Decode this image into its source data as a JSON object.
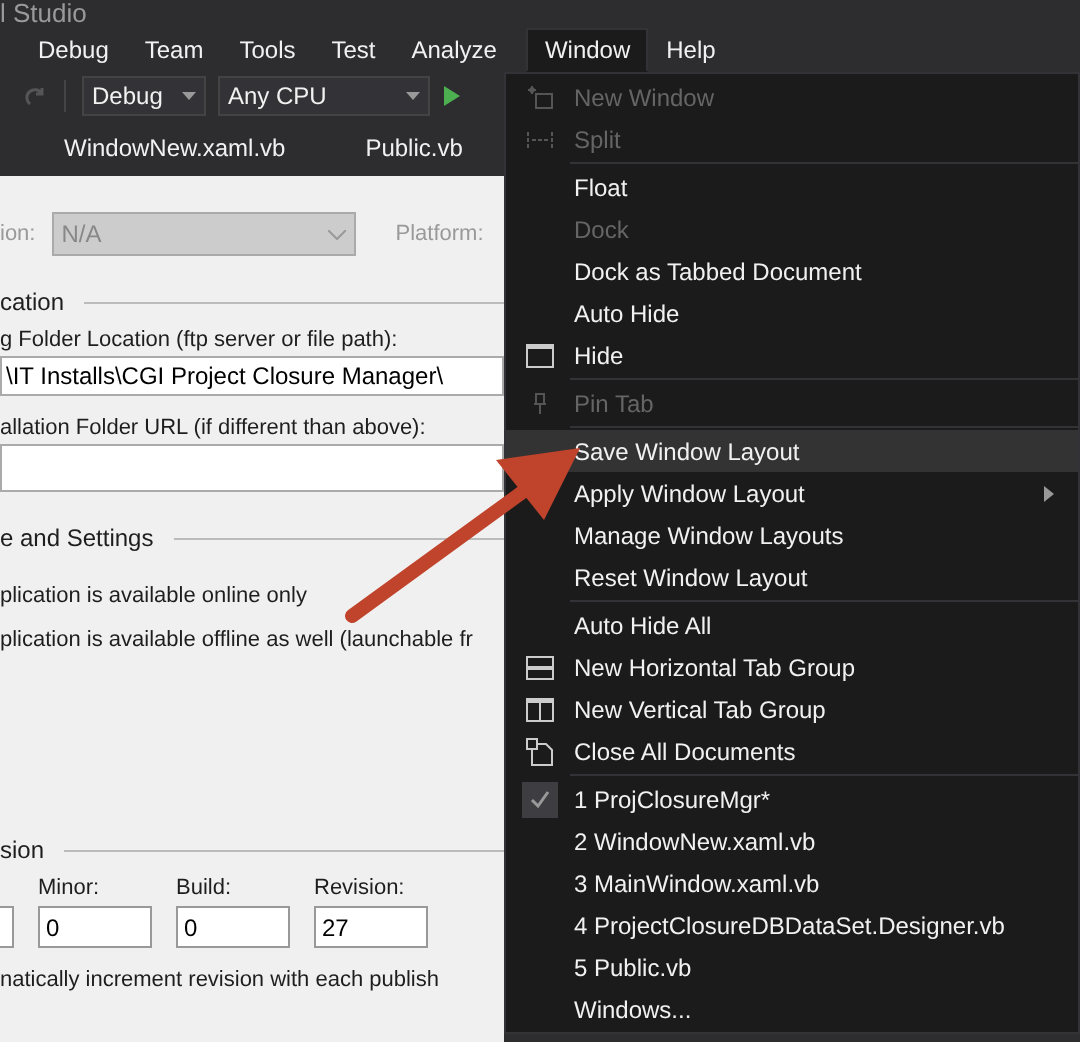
{
  "window": {
    "title": "l Studio"
  },
  "menu_bar": [
    {
      "label": "Debug",
      "selected": false
    },
    {
      "label": "Team",
      "selected": false
    },
    {
      "label": "Tools",
      "selected": false
    },
    {
      "label": "Test",
      "selected": false
    },
    {
      "label": "Analyze",
      "selected": false
    },
    {
      "label": "Window",
      "selected": true
    },
    {
      "label": "Help",
      "selected": false
    }
  ],
  "toolbar": {
    "configuration": "Debug",
    "platform": "Any CPU"
  },
  "tabs": [
    {
      "label": "WindowNew.xaml.vb"
    },
    {
      "label": "Public.vb"
    }
  ],
  "form": {
    "configuration_label": "ion:",
    "configuration_value": "N/A",
    "platform_label": "Platform:",
    "publish_section": "cation",
    "folder_label": "g Folder Location (ftp server or file path):",
    "folder_value": "\\IT Installs\\CGI Project Closure Manager\\",
    "install_label": "allation Folder URL (if different than above):",
    "settings_section": "e and Settings",
    "options": [
      "plication is available online only",
      "plication is available offline as well (launchable fr"
    ],
    "version_section": "sion",
    "version_fields": [
      {
        "label": "Minor:",
        "value": "0"
      },
      {
        "label": "Build:",
        "value": "0"
      },
      {
        "label": "Revision:",
        "value": "27"
      }
    ],
    "auto_increment_label": "natically increment revision with each publish"
  },
  "menu": {
    "groups": [
      [
        {
          "label": "New Window",
          "kind": "newwindow",
          "disabled": true,
          "selected": false
        },
        {
          "label": "Split",
          "kind": "split",
          "disabled": true,
          "selected": false
        }
      ],
      [
        {
          "label": "Float",
          "kind": "plain",
          "disabled": false,
          "selected": false
        },
        {
          "label": "Dock",
          "kind": "plain",
          "disabled": true,
          "selected": false
        },
        {
          "label": "Dock as Tabbed Document",
          "kind": "plain",
          "disabled": false,
          "selected": false
        },
        {
          "label": "Auto Hide",
          "kind": "plain",
          "disabled": false,
          "selected": false
        },
        {
          "label": "Hide",
          "kind": "window",
          "disabled": false,
          "selected": false
        }
      ],
      [
        {
          "label": "Pin Tab",
          "kind": "pin",
          "disabled": true,
          "selected": false
        }
      ],
      [
        {
          "label": "Save Window Layout",
          "kind": "plain",
          "disabled": false,
          "selected": true
        },
        {
          "label": "Apply Window Layout",
          "kind": "plain",
          "disabled": false,
          "selected": false,
          "submenu": true
        },
        {
          "label": "Manage Window Layouts",
          "kind": "plain",
          "disabled": false,
          "selected": false
        },
        {
          "label": "Reset Window Layout",
          "kind": "plain",
          "disabled": false,
          "selected": false
        }
      ],
      [
        {
          "label": "Auto Hide All",
          "kind": "plain",
          "disabled": false,
          "selected": false
        },
        {
          "label": "New Horizontal Tab Group",
          "kind": "hgroup",
          "disabled": false,
          "selected": false
        },
        {
          "label": "New Vertical Tab Group",
          "kind": "vgroup",
          "disabled": false,
          "selected": false
        },
        {
          "label": "Close All Documents",
          "kind": "documents",
          "disabled": false,
          "selected": false
        }
      ],
      [
        {
          "label": "1 ProjClosureMgr*",
          "kind": "plain",
          "checked": true,
          "disabled": false,
          "selected": false
        },
        {
          "label": "2 WindowNew.xaml.vb",
          "kind": "plain",
          "checked": false,
          "disabled": false,
          "selected": false
        },
        {
          "label": "3 MainWindow.xaml.vb",
          "kind": "plain",
          "checked": false,
          "disabled": false,
          "selected": false
        },
        {
          "label": "4 ProjectClosureDBDataSet.Designer.vb",
          "kind": "plain",
          "checked": false,
          "disabled": false,
          "selected": false
        },
        {
          "label": "5 Public.vb",
          "kind": "plain",
          "checked": false,
          "disabled": false,
          "selected": false
        },
        {
          "label": "Windows...",
          "kind": "plain",
          "checked": false,
          "disabled": false,
          "selected": false
        }
      ]
    ]
  }
}
